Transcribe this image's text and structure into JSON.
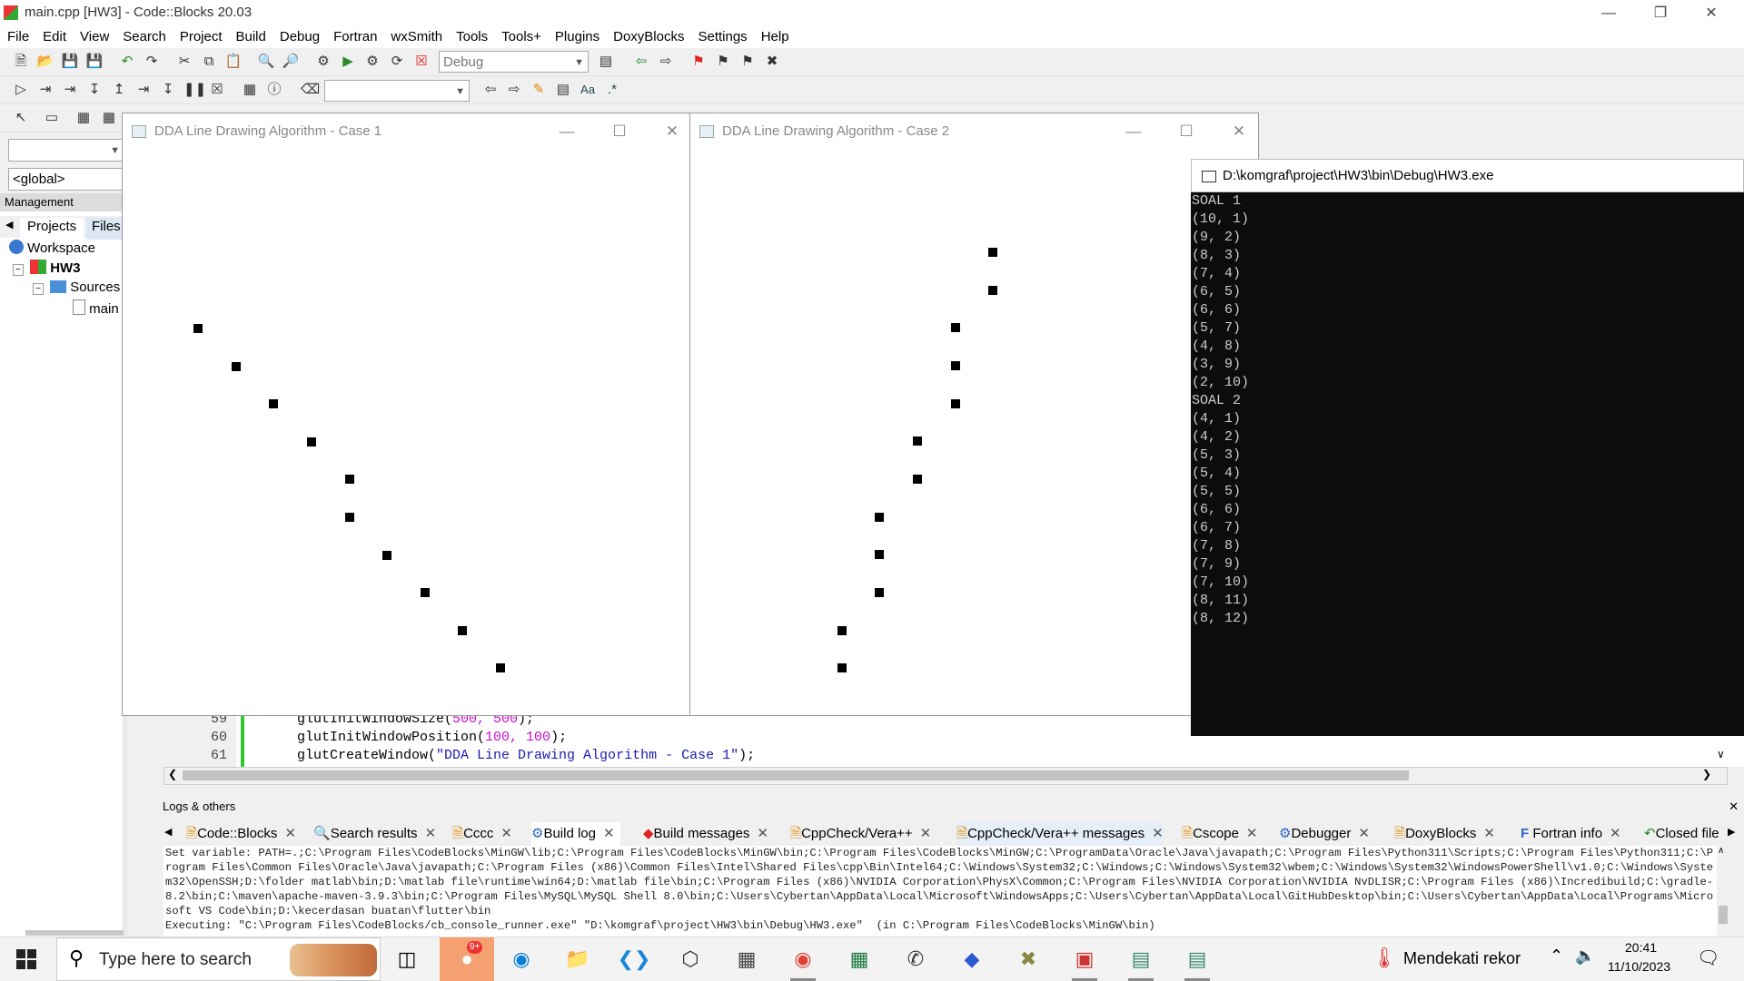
{
  "ide": {
    "title": "main.cpp [HW3] - Code::Blocks 20.03",
    "menu": [
      "File",
      "Edit",
      "View",
      "Search",
      "Project",
      "Build",
      "Debug",
      "Fortran",
      "wxSmith",
      "Tools",
      "Tools+",
      "Plugins",
      "DoxyBlocks",
      "Settings",
      "Help"
    ],
    "build_target": "Debug",
    "scope_combo": "<global>",
    "management_title": "Management",
    "mgmt_tabs": [
      "Projects",
      "Files"
    ],
    "tree": {
      "workspace": "Workspace",
      "project": "HW3",
      "folder": "Sources",
      "file": "main"
    }
  },
  "editor": {
    "lines": [
      {
        "num": "59",
        "code_pre": "glutInitWindowSize(",
        "args": "500, 500",
        "code_post": ");",
        "is_string": false
      },
      {
        "num": "60",
        "code_pre": "glutInitWindowPosition(",
        "args": "100, 100",
        "code_post": ");",
        "is_string": false
      },
      {
        "num": "61",
        "code_pre": "glutCreateWindow(",
        "args": "\"DDA Line Drawing Algorithm - Case 1\"",
        "code_post": ");",
        "is_string": true
      }
    ]
  },
  "gl_windows": [
    {
      "title": "DDA Line Drawing Algorithm - Case 1"
    },
    {
      "title": "DDA Line Drawing Algorithm - Case 2"
    }
  ],
  "console": {
    "title": "D:\\komgraf\\project\\HW3\\bin\\Debug\\HW3.exe",
    "output": "SOAL 1\n(10, 1)\n(9, 2)\n(8, 3)\n(7, 4)\n(6, 5)\n(6, 6)\n(5, 7)\n(4, 8)\n(3, 9)\n(2, 10)\nSOAL 2\n(4, 1)\n(4, 2)\n(5, 3)\n(5, 4)\n(5, 5)\n(6, 6)\n(6, 7)\n(7, 8)\n(7, 9)\n(7, 10)\n(8, 11)\n(8, 12)"
  },
  "case1_points": [
    [
      10,
      1
    ],
    [
      9,
      2
    ],
    [
      8,
      3
    ],
    [
      7,
      4
    ],
    [
      6,
      5
    ],
    [
      6,
      6
    ],
    [
      5,
      7
    ],
    [
      4,
      8
    ],
    [
      3,
      9
    ],
    [
      2,
      10
    ]
  ],
  "case2_points": [
    [
      4,
      1
    ],
    [
      4,
      2
    ],
    [
      5,
      3
    ],
    [
      5,
      4
    ],
    [
      5,
      5
    ],
    [
      6,
      6
    ],
    [
      6,
      7
    ],
    [
      7,
      8
    ],
    [
      7,
      9
    ],
    [
      7,
      10
    ],
    [
      8,
      11
    ],
    [
      8,
      12
    ]
  ],
  "logs": {
    "header": "Logs & others",
    "tabs": [
      "Code::Blocks",
      "Search results",
      "Cccc",
      "Build log",
      "Build messages",
      "CppCheck/Vera++",
      "CppCheck/Vera++ messages",
      "Cscope",
      "Debugger",
      "DoxyBlocks",
      "Fortran info",
      "Closed file"
    ],
    "active_tab": "Build log",
    "body": "Set variable: PATH=.;C:\\Program Files\\CodeBlocks\\MinGW\\lib;C:\\Program Files\\CodeBlocks\\MinGW\\bin;C:\\Program Files\\CodeBlocks\\MinGW;C:\\ProgramData\\Oracle\\Java\\javapath;C:\\Program Files\\Python311\\Scripts;C:\\Program Files\\Python311;C:\\Program Files\\Common Files\\Oracle\\Java\\javapath;C:\\Program Files (x86)\\Common Files\\Intel\\Shared Files\\cpp\\Bin\\Intel64;C:\\Windows\\System32;C:\\Windows;C:\\Windows\\System32\\wbem;C:\\Windows\\System32\\WindowsPowerShell\\v1.0;C:\\Windows\\System32\\OpenSSH;D:\\folder matlab\\bin;D:\\matlab file\\runtime\\win64;D:\\matlab file\\bin;C:\\Program Files (x86)\\NVIDIA Corporation\\PhysX\\Common;C:\\Program Files\\NVIDIA Corporation\\NVIDIA NvDLISR;C:\\Program Files (x86)\\Incredibuild;C:\\gradle-8.2\\bin;C:\\maven\\apache-maven-3.9.3\\bin;C:\\Program Files\\MySQL\\MySQL Shell 8.0\\bin;C:\\Users\\Cybertan\\AppData\\Local\\Microsoft\\WindowsApps;C:\\Users\\Cybertan\\AppData\\Local\\GitHubDesktop\\bin;C:\\Users\\Cybertan\\AppData\\Local\\Programs\\Microsoft VS Code\\bin;D:\\kecerdasan buatan\\flutter\\bin\nExecuting: \"C:\\Program Files\\CodeBlocks/cb_console_runner.exe\" \"D:\\komgraf\\project\\HW3\\bin\\Debug\\HW3.exe\"  (in C:\\Program Files\\CodeBlocks\\MinGW\\bin)"
  },
  "taskbar": {
    "search_placeholder": "Type here to search",
    "weather": "Mendekati rekor",
    "time": "20:41",
    "date": "11/10/2023",
    "chat_badge": "9+"
  }
}
